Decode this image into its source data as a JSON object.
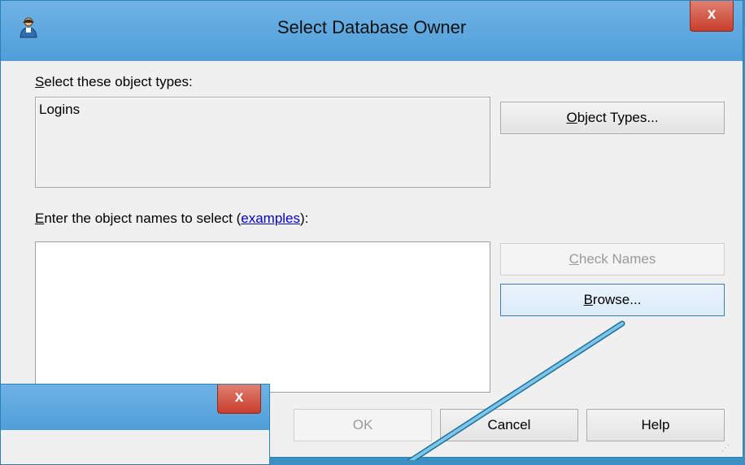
{
  "dialog": {
    "title": "Select Database Owner",
    "close_label": "x",
    "object_types_label_prefix": "elect these object types:",
    "object_types_label_access": "S",
    "object_types_value": "Logins",
    "object_types_button_access": "O",
    "object_types_button_rest": "bject Types...",
    "names_label_access": "E",
    "names_label_prefix": "nter the object names to select (",
    "names_label_link": "examples",
    "names_label_suffix": "):",
    "names_value": "",
    "check_names_access": "C",
    "check_names_rest": "heck Names",
    "browse_access": "B",
    "browse_rest": "rowse...",
    "ok_label": "OK",
    "cancel_label": "Cancel",
    "help_label": "Help"
  },
  "dialog2": {
    "close_label": "x"
  },
  "colors": {
    "titlebar": "#5aa6dd",
    "close": "#c73d2b",
    "callout": "#5fb0d8"
  }
}
